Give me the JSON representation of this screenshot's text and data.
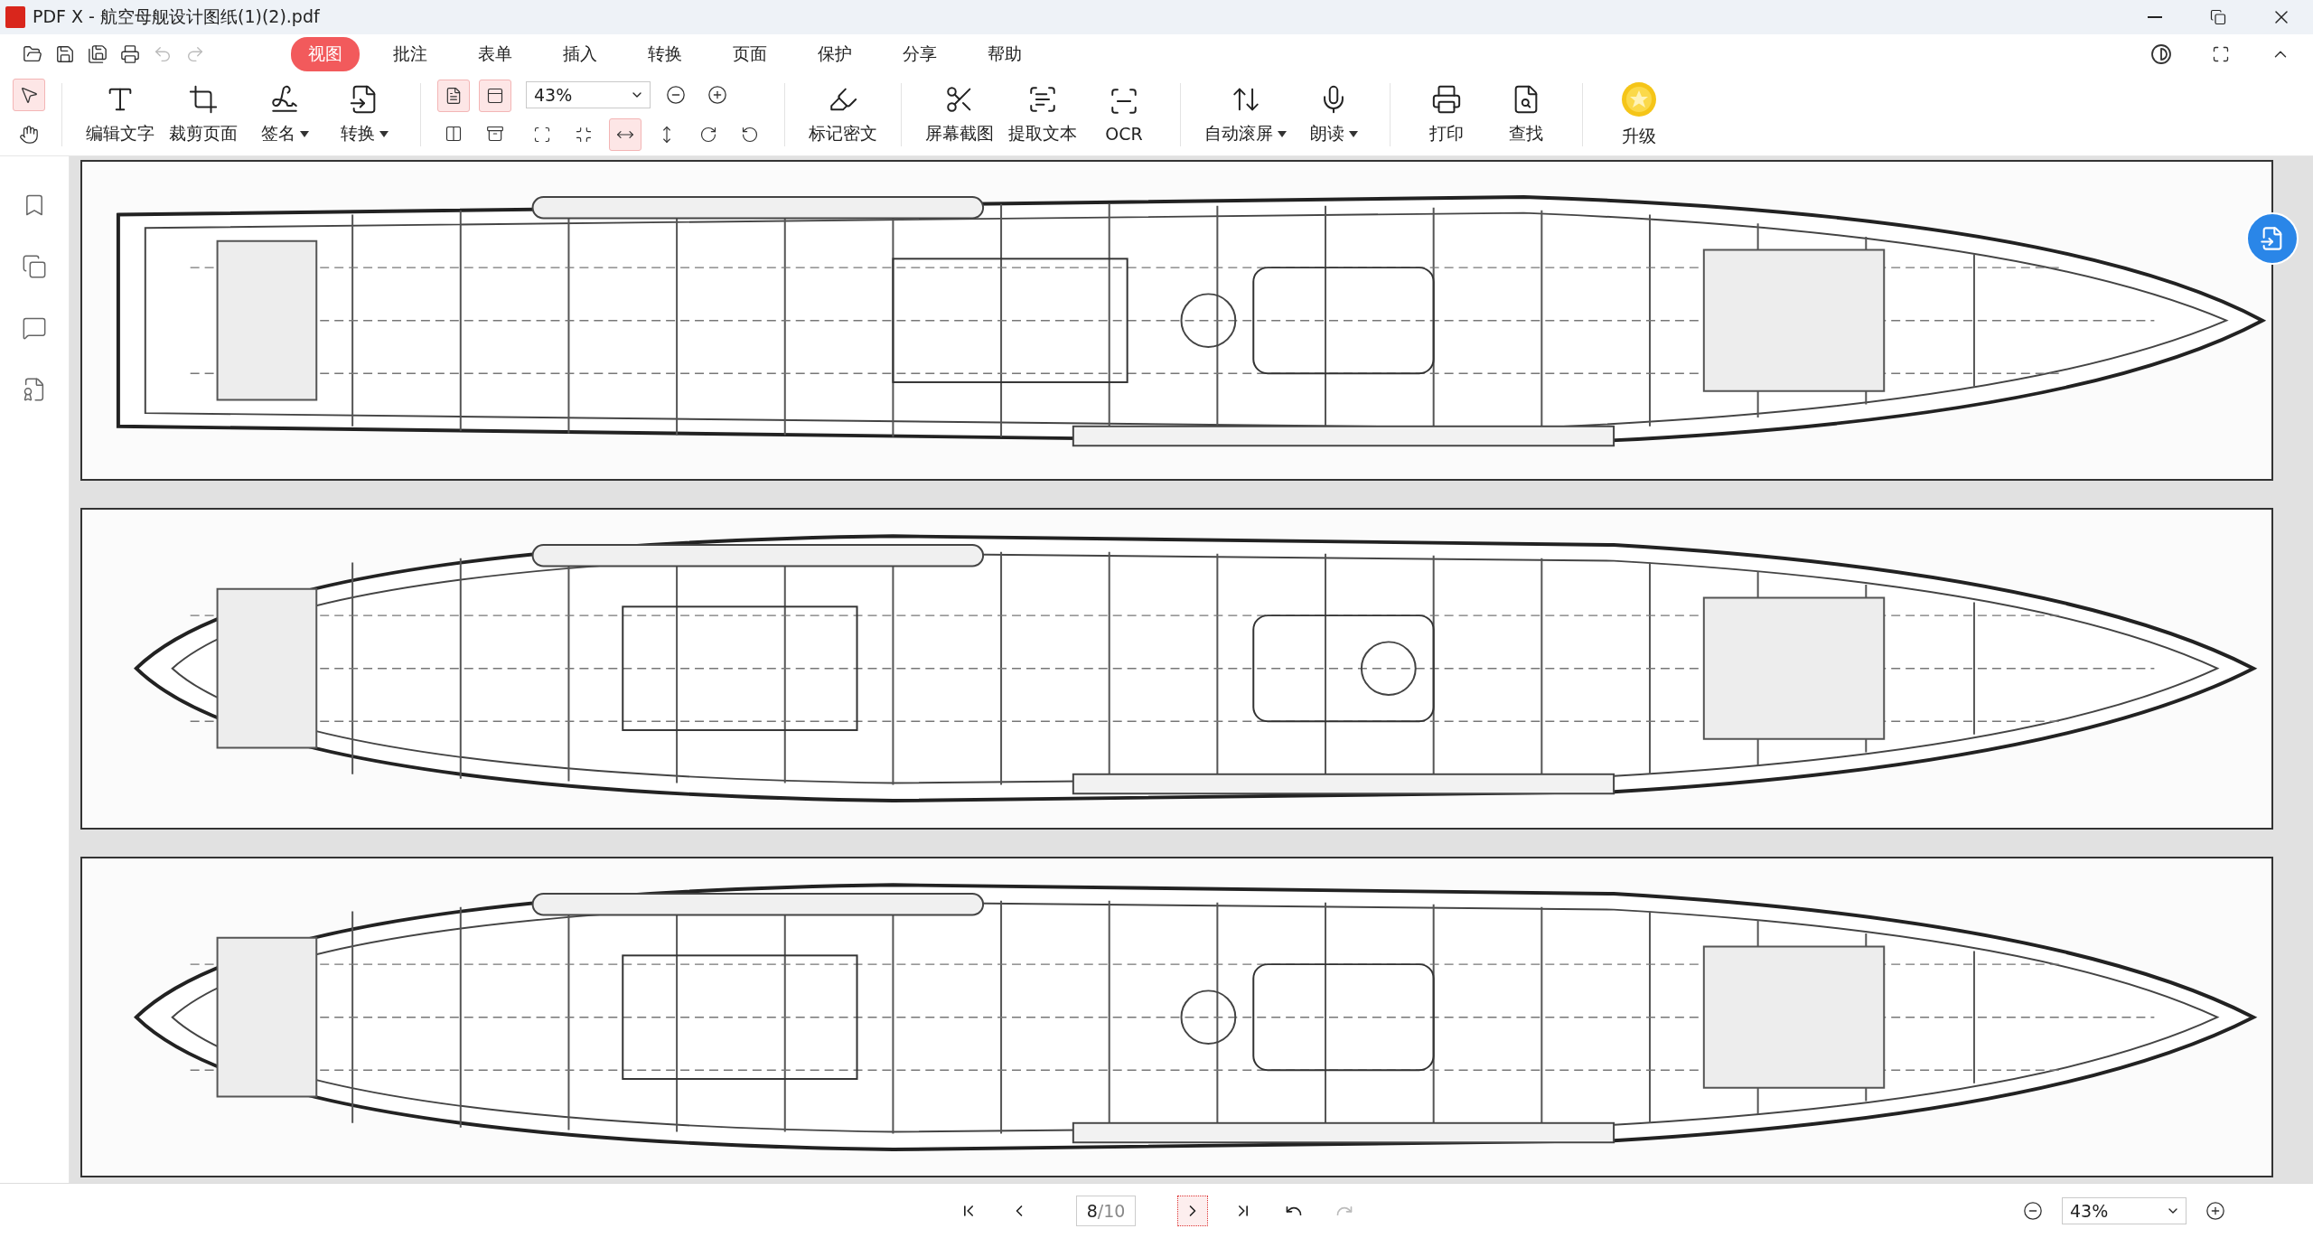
{
  "window": {
    "title": "PDF X - 航空母舰设计图纸(1)(2).pdf"
  },
  "quick_access": [
    {
      "disabled": false
    },
    {
      "disabled": false
    },
    {
      "disabled": false
    },
    {
      "disabled": false
    },
    {
      "disabled": true
    },
    {
      "disabled": true
    }
  ],
  "menu_tabs": [
    {
      "label": "视图",
      "selected": true
    },
    {
      "label": "批注",
      "selected": false
    },
    {
      "label": "表单",
      "selected": false
    },
    {
      "label": "插入",
      "selected": false
    },
    {
      "label": "转换",
      "selected": false
    },
    {
      "label": "页面",
      "selected": false
    },
    {
      "label": "保护",
      "selected": false
    },
    {
      "label": "分享",
      "selected": false
    },
    {
      "label": "帮助",
      "selected": false
    }
  ],
  "toolbar": {
    "pointer_tools": [
      {
        "selected": true
      },
      {
        "selected": false
      }
    ],
    "edit_tools": [
      {
        "label": "编辑文字",
        "dropdown": false
      },
      {
        "label": "裁剪页面",
        "dropdown": false
      },
      {
        "label": "签名",
        "dropdown": true
      },
      {
        "label": "转换",
        "dropdown": true
      }
    ],
    "view_modes": [
      {
        "selected": true
      },
      {
        "selected": true
      },
      {
        "selected": false
      },
      {
        "selected": false
      }
    ],
    "zoom": {
      "value": "43%"
    },
    "fit_modes": [
      {
        "selected": false
      },
      {
        "selected": false
      },
      {
        "selected": true
      },
      {
        "selected": false
      },
      {
        "selected": false
      },
      {
        "selected": false
      }
    ],
    "tool_groups": [
      [
        {
          "label": "标记密文",
          "dropdown": false
        }
      ],
      [
        {
          "label": "屏幕截图",
          "dropdown": false
        },
        {
          "label": "提取文本",
          "dropdown": false
        },
        {
          "label": "OCR",
          "dropdown": false
        }
      ],
      [
        {
          "label": "自动滚屏",
          "dropdown": true
        },
        {
          "label": "朗读",
          "dropdown": true
        }
      ],
      [
        {
          "label": "打印",
          "dropdown": false
        },
        {
          "label": "查找",
          "dropdown": false
        }
      ],
      [
        {
          "label": "升级",
          "dropdown": false
        }
      ]
    ]
  },
  "status_bar": {
    "nav": [
      {
        "selected": false,
        "disabled": false
      },
      {
        "selected": false,
        "disabled": false
      },
      {
        "selected": true,
        "disabled": false
      },
      {
        "selected": false,
        "disabled": false
      },
      {
        "selected": false,
        "disabled": false
      },
      {
        "selected": false,
        "disabled": true
      }
    ],
    "page": {
      "value": "8",
      "total": "/10"
    },
    "zoom": {
      "value": "43%"
    }
  }
}
